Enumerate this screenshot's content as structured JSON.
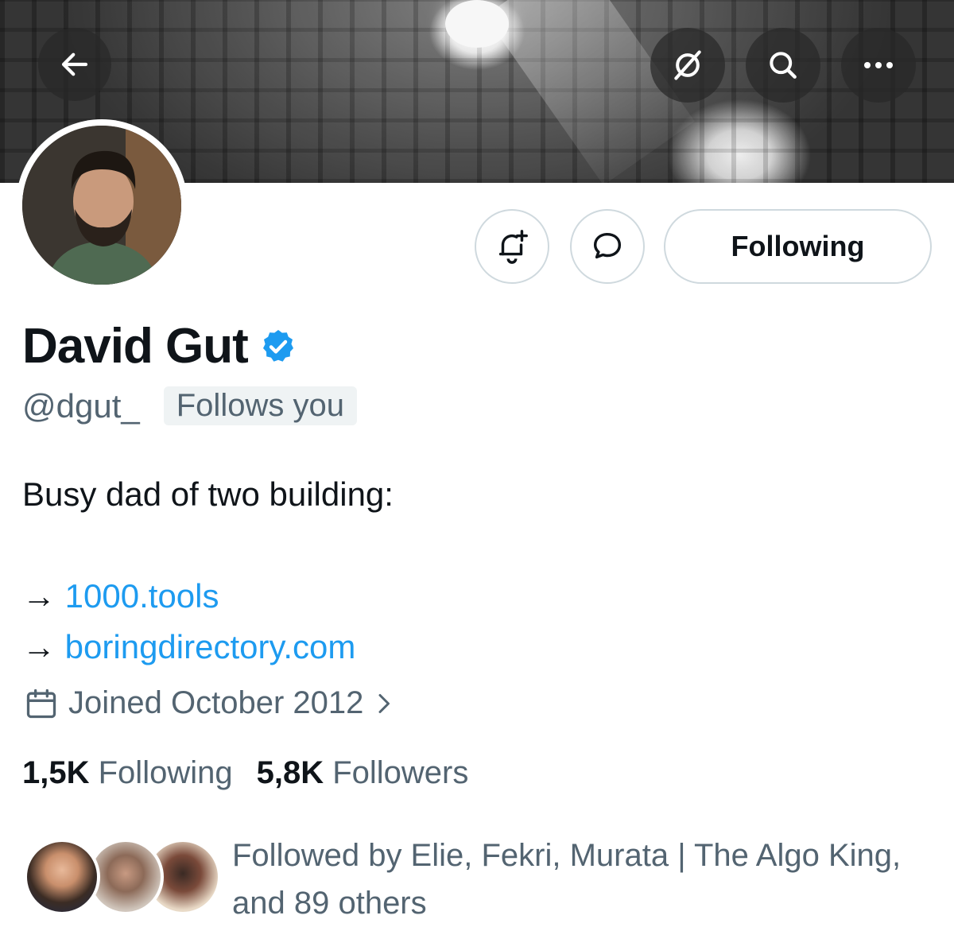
{
  "header": {
    "back_icon": "arrow-left-icon",
    "grok_icon": "grok-slash-icon",
    "search_icon": "search-icon",
    "more_icon": "more-dots-icon"
  },
  "profile": {
    "name": "David Gut",
    "verified": true,
    "handle": "@dgut_",
    "follows_you": "Follows you",
    "bio_line1": "Busy dad of two building:",
    "bio_links": [
      {
        "arrow": "→",
        "text": "1000.tools"
      },
      {
        "arrow": "→",
        "text": "boringdirectory.com"
      }
    ],
    "joined": "Joined October 2012",
    "following_count": "1,5K",
    "following_label": "Following",
    "followers_count": "5,8K",
    "followers_label": "Followers"
  },
  "actions": {
    "notify_icon": "bell-plus-icon",
    "message_icon": "message-bubble-icon",
    "following_button": "Following"
  },
  "followed_by": {
    "line1": "Followed by Elie, Fekri, Murata | The Algo King,",
    "line2": "and 89 others"
  },
  "colors": {
    "accent": "#1d9bf0",
    "text": "#0f1419",
    "muted": "#536471",
    "verified": "#1d9bf0"
  }
}
